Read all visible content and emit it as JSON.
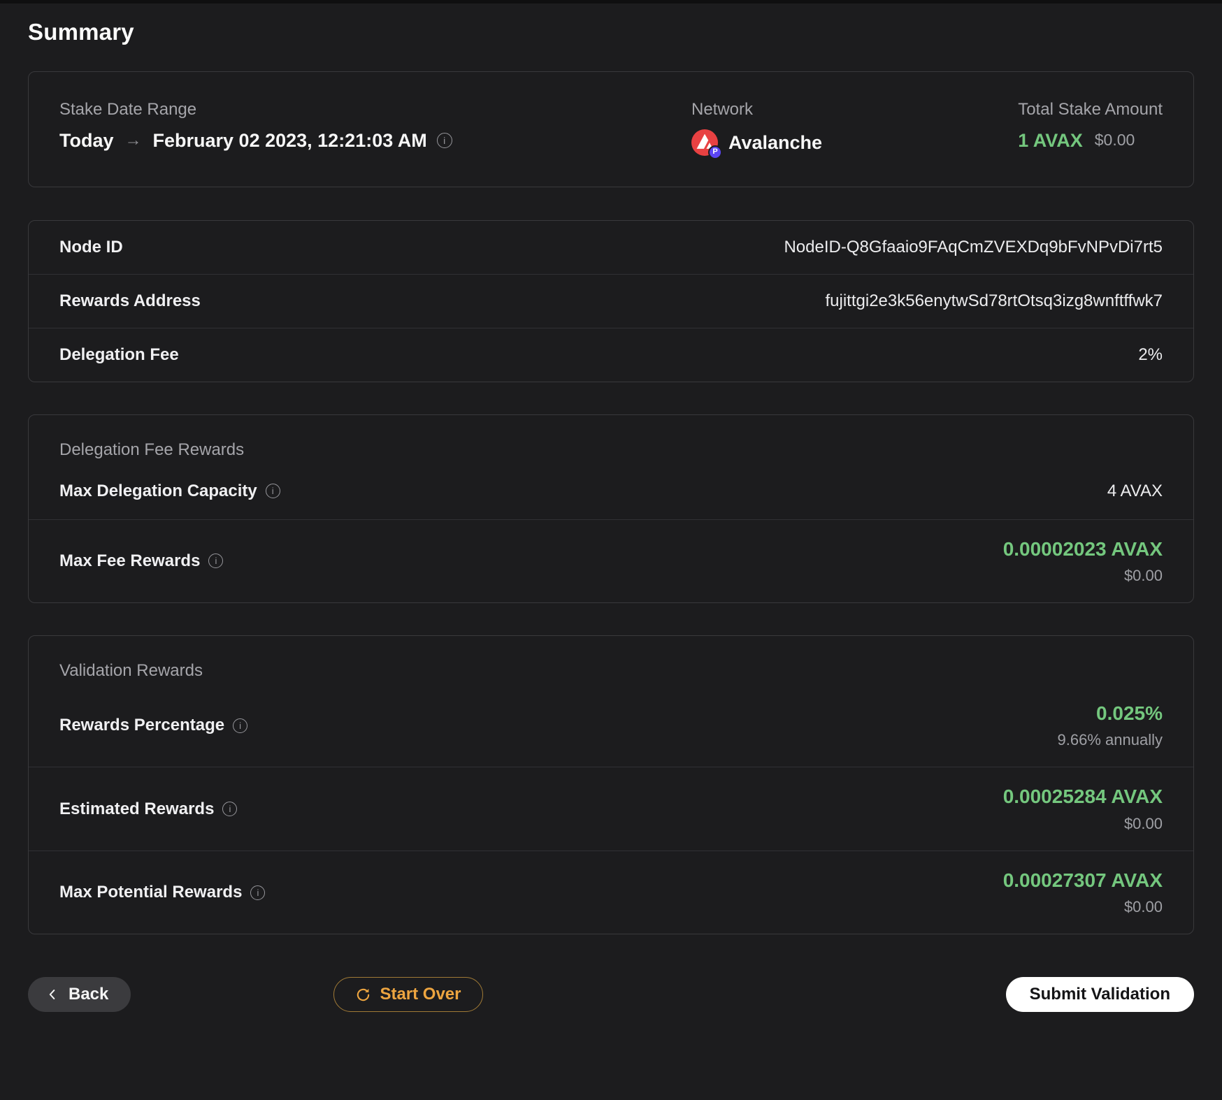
{
  "page": {
    "title": "Summary"
  },
  "colors": {
    "accent_green": "#74c77e",
    "accent_orange": "#eda540",
    "avalanche_red": "#e84142",
    "badge_purple": "#5b45f5"
  },
  "icons": {
    "info": "i",
    "arrow_right": "→"
  },
  "summary_card": {
    "stake_date_range": {
      "label": "Stake Date Range",
      "from": "Today",
      "to": "February 02 2023, 12:21:03 AM"
    },
    "network": {
      "label": "Network",
      "name": "Avalanche",
      "badge": "P"
    },
    "total_stake": {
      "label": "Total Stake Amount",
      "amount": "1 AVAX",
      "usd": "$0.00"
    }
  },
  "details_table": {
    "rows": [
      {
        "label": "Node ID",
        "value": "NodeID-Q8Gfaaio9FAqCmZVEXDq9bFvNPvDi7rt5"
      },
      {
        "label": "Rewards Address",
        "value": "fujittgi2e3k56enytwSd78rtOtsq3izg8wnftffwk7"
      },
      {
        "label": "Delegation Fee",
        "value": "2%"
      }
    ]
  },
  "delegation_fee_rewards": {
    "title": "Delegation Fee Rewards",
    "max_delegation_capacity": {
      "label": "Max Delegation Capacity",
      "value": "4 AVAX"
    },
    "max_fee_rewards": {
      "label": "Max Fee Rewards",
      "value": "0.00002023 AVAX",
      "usd": "$0.00"
    }
  },
  "validation_rewards": {
    "title": "Validation Rewards",
    "rewards_percentage": {
      "label": "Rewards Percentage",
      "value": "0.025%",
      "sub": "9.66% annually"
    },
    "estimated_rewards": {
      "label": "Estimated Rewards",
      "value": "0.00025284 AVAX",
      "usd": "$0.00"
    },
    "max_potential_rewards": {
      "label": "Max Potential Rewards",
      "value": "0.00027307 AVAX",
      "usd": "$0.00"
    }
  },
  "footer": {
    "back_label": "Back",
    "start_over_label": "Start Over",
    "submit_label": "Submit Validation"
  }
}
